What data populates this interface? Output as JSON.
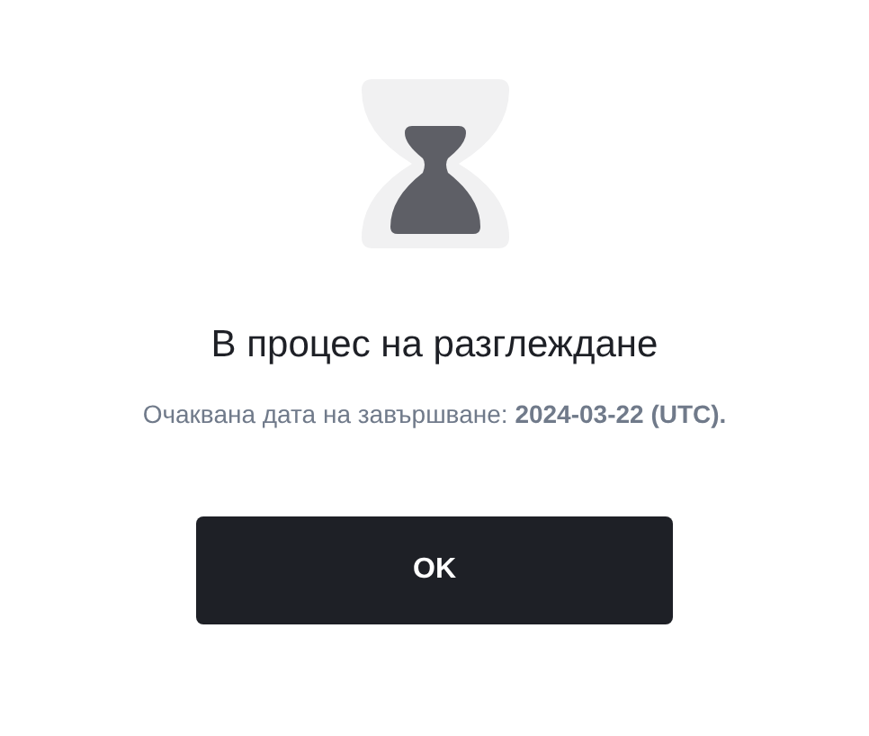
{
  "title": "В процес на разглеждане",
  "subtitle": "Очаквана дата на завършване: **2024-03-22 (UTC).**",
  "button": "OK"
}
